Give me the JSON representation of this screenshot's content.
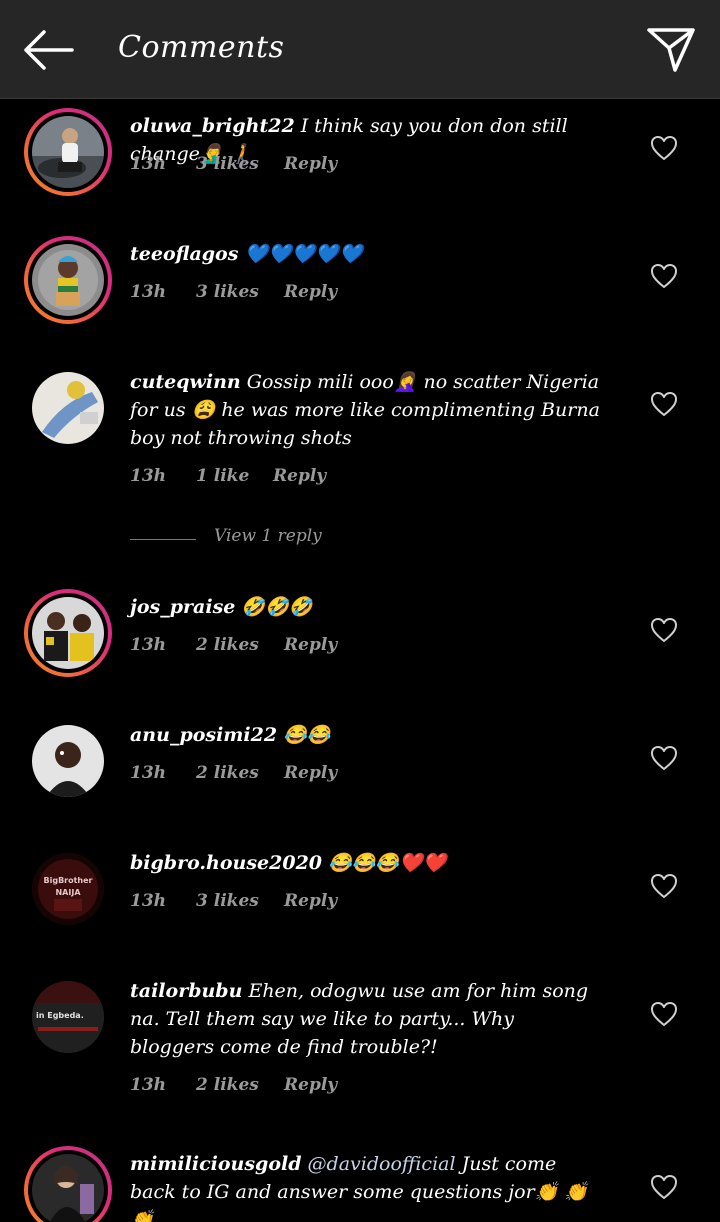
{
  "header": {
    "title": "Comments",
    "back_icon": "arrow-left-icon",
    "send_icon": "paper-plane-icon"
  },
  "comments": [
    {
      "username": "oluwa_bright22",
      "text": " I think say you don don still change🤦‍♂️ 🚶",
      "time": "13h",
      "likes": "3 likes",
      "reply": "Reply"
    },
    {
      "username": "teeoflagos",
      "text": " 💙💙💙💙💙",
      "time": "13h",
      "likes": "3 likes",
      "reply": "Reply"
    },
    {
      "username": "cuteqwinn",
      "text": " Gossip mili ooo🤦‍♀️ no scatter Nigeria for us 😩 he was more like complimenting Burna boy not throwing shots",
      "time": "13h",
      "likes": "1 like",
      "reply": "Reply",
      "view_replies": "View 1 reply"
    },
    {
      "username": "jos_praise",
      "text": " 🤣🤣🤣",
      "time": "13h",
      "likes": "2 likes",
      "reply": "Reply"
    },
    {
      "username": "anu_posimi22",
      "text": " 😂😂",
      "time": "13h",
      "likes": "2 likes",
      "reply": "Reply"
    },
    {
      "username": "bigbro.house2020",
      "text": " 😂😂😂❤️❤️",
      "time": "13h",
      "likes": "3 likes",
      "reply": "Reply",
      "avatar_text": "BigBrother NAIJA"
    },
    {
      "username": "tailorbubu",
      "text": " Ehen, odogwu use am for him song na. Tell them say we like to party... Why bloggers come de find trouble?!",
      "time": "13h",
      "likes": "2 likes",
      "reply": "Reply",
      "avatar_text": "in Egbeda."
    },
    {
      "username": "mimiliciousgold",
      "mention": " @davidoofficial",
      "text": " Just come back to IG and answer some questions jor👏 👏 👏"
    }
  ],
  "icons": {
    "heart": "heart-outline-icon"
  },
  "colors": {
    "background": "#000000",
    "header": "#262626",
    "meta": "#9a9a9a",
    "ring_start": "#f58529",
    "ring_end": "#c13584"
  }
}
